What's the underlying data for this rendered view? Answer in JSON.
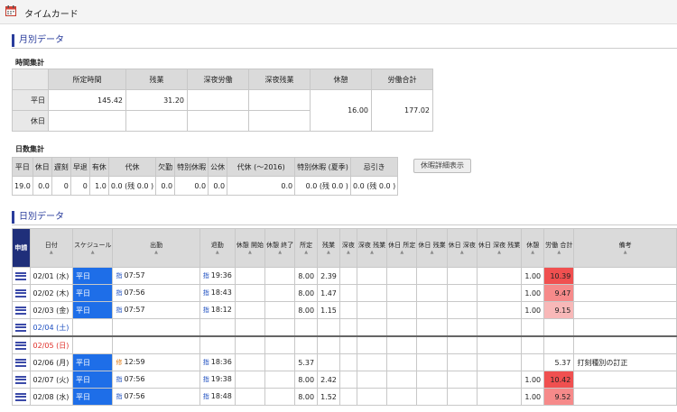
{
  "window": {
    "title": "タイムカード",
    "icon": "calendar-icon"
  },
  "monthly": {
    "section_title": "月別データ",
    "hours": {
      "heading": "時間集計",
      "columns": [
        "所定時間",
        "残業",
        "深夜労働",
        "深夜残業",
        "休憩",
        "労働合計"
      ],
      "rows": [
        {
          "label": "平日",
          "cells": [
            "145.42",
            "31.20",
            "",
            ""
          ]
        },
        {
          "label": "休日",
          "cells": [
            "",
            "",
            "",
            ""
          ]
        }
      ],
      "break_total": "16.00",
      "labor_total": "177.02"
    },
    "days": {
      "heading": "日数集計",
      "columns": [
        "平日",
        "休日",
        "遅刻",
        "早退",
        "有休",
        "代休",
        "欠勤",
        "特別休暇",
        "公休",
        "代休 (～2016)",
        "特別休暇 (夏季)",
        "忌引き"
      ],
      "values": [
        "19.0",
        "0.0",
        "0",
        "0",
        "1.0",
        "0.0 (残 0.0 )",
        "0.0",
        "0.0",
        "0.0",
        "0.0",
        "0.0 (残 0.0 )",
        "0.0 (残 0.0 )"
      ]
    },
    "leave_detail_button": "休暇詳細表示"
  },
  "daily": {
    "section_title": "日別データ",
    "columns": [
      "申請",
      "日付",
      "スケジュール",
      "出勤",
      "退勤",
      "休憩 開始",
      "休憩 終了",
      "所定",
      "残業",
      "深夜",
      "深夜 残業",
      "休日 所定",
      "休日 残業",
      "休日 深夜",
      "休日 深夜 残業",
      "休憩",
      "労働 合計",
      "備考"
    ],
    "rows": [
      {
        "date": "02/01 (水)",
        "day_type": "weekday",
        "schedule": "平日",
        "in_icon": "指",
        "in": "07:57",
        "out_icon": "指",
        "out": "19:36",
        "scheduled": "8.00",
        "overtime": "2.39",
        "break": "1.00",
        "total": "10.39",
        "total_hl": "dark",
        "note": ""
      },
      {
        "date": "02/02 (木)",
        "day_type": "weekday",
        "schedule": "平日",
        "in_icon": "指",
        "in": "07:56",
        "out_icon": "指",
        "out": "18:43",
        "scheduled": "8.00",
        "overtime": "1.47",
        "break": "1.00",
        "total": "9.47",
        "total_hl": "mid",
        "note": ""
      },
      {
        "date": "02/03 (金)",
        "day_type": "weekday",
        "schedule": "平日",
        "in_icon": "指",
        "in": "07:57",
        "out_icon": "指",
        "out": "18:12",
        "scheduled": "8.00",
        "overtime": "1.15",
        "break": "1.00",
        "total": "9.15",
        "total_hl": "light",
        "note": ""
      },
      {
        "date": "02/04 (土)",
        "day_type": "sat",
        "schedule": "",
        "in_icon": "",
        "in": "",
        "out_icon": "",
        "out": "",
        "scheduled": "",
        "overtime": "",
        "break": "",
        "total": "",
        "total_hl": "",
        "note": ""
      },
      {
        "date": "02/05 (日)",
        "day_type": "sun",
        "schedule": "",
        "in_icon": "",
        "in": "",
        "out_icon": "",
        "out": "",
        "scheduled": "",
        "overtime": "",
        "break": "",
        "total": "",
        "total_hl": "",
        "note": ""
      },
      {
        "date": "02/06 (月)",
        "day_type": "weekday",
        "schedule": "平日",
        "in_icon": "修",
        "in": "12:59",
        "out_icon": "指",
        "out": "18:36",
        "scheduled": "5.37",
        "overtime": "",
        "break": "",
        "total": "5.37",
        "total_hl": "",
        "note": "打刻種別の訂正"
      },
      {
        "date": "02/07 (火)",
        "day_type": "weekday",
        "schedule": "平日",
        "in_icon": "指",
        "in": "07:56",
        "out_icon": "指",
        "out": "19:38",
        "scheduled": "8.00",
        "overtime": "2.42",
        "break": "1.00",
        "total": "10.42",
        "total_hl": "dark",
        "note": ""
      },
      {
        "date": "02/08 (水)",
        "day_type": "weekday",
        "schedule": "平日",
        "in_icon": "指",
        "in": "07:56",
        "out_icon": "指",
        "out": "18:48",
        "scheduled": "8.00",
        "overtime": "1.52",
        "break": "1.00",
        "total": "9.52",
        "total_hl": "mid",
        "note": ""
      }
    ]
  }
}
